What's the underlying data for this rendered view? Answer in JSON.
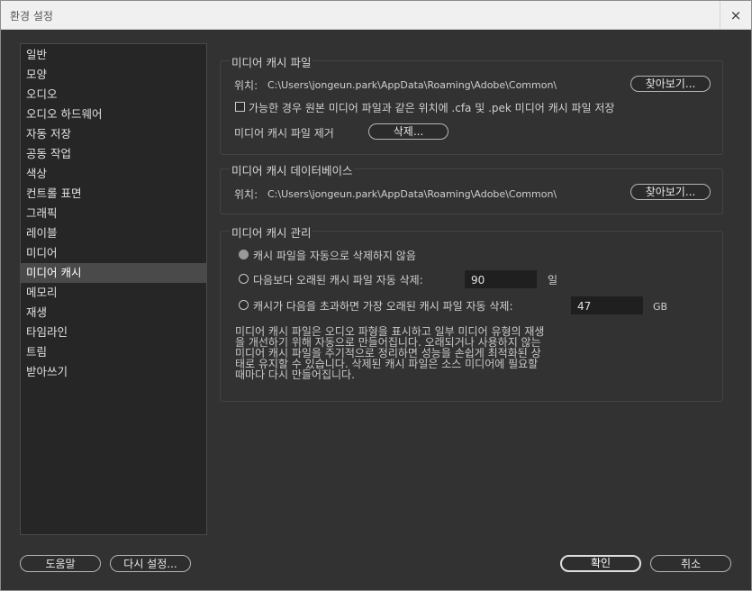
{
  "window": {
    "title": "환경 설정",
    "close_glyph": "×"
  },
  "sidebar": {
    "items": [
      {
        "label": "일반"
      },
      {
        "label": "모양"
      },
      {
        "label": "오디오"
      },
      {
        "label": "오디오 하드웨어"
      },
      {
        "label": "자동 저장"
      },
      {
        "label": "공동 작업"
      },
      {
        "label": "색상"
      },
      {
        "label": "컨트롤 표면"
      },
      {
        "label": "그래픽"
      },
      {
        "label": "레이블"
      },
      {
        "label": "미디어"
      },
      {
        "label": "미디어 캐시",
        "selected": true
      },
      {
        "label": "메모리"
      },
      {
        "label": "재생"
      },
      {
        "label": "타임라인"
      },
      {
        "label": "트림"
      },
      {
        "label": "받아쓰기"
      }
    ]
  },
  "cache_files": {
    "title": "미디어 캐시 파일",
    "location_label": "위치:",
    "location_path": "C:\\Users\\jongeun.park\\AppData\\Roaming\\Adobe\\Common\\",
    "browse_label": "찾아보기...",
    "save_next_to_originals_label": "가능한 경우 원본 미디어 파일과 같은 위치에 .cfa 및 .pek 미디어 캐시 파일 저장",
    "remove_label": "미디어 캐시 파일 제거",
    "delete_label": "삭제..."
  },
  "cache_db": {
    "title": "미디어 캐시 데이터베이스",
    "location_label": "위치:",
    "location_path": "C:\\Users\\jongeun.park\\AppData\\Roaming\\Adobe\\Common\\",
    "browse_label": "찾아보기..."
  },
  "cache_mgmt": {
    "title": "미디어 캐시 관리",
    "option_never_delete": "캐시 파일을 자동으로 삭제하지 않음",
    "option_delete_older": "다음보다 오래된 캐시 파일 자동 삭제:",
    "older_than_value": "90",
    "older_than_unit": "일",
    "option_delete_exceeds": "캐시가 다음을 초과하면 가장 오래된 캐시 파일 자동 삭제:",
    "exceeds_value": "47",
    "exceeds_unit": "GB",
    "selected_option": "never_delete",
    "description_lines": [
      "미디어 캐시 파일은 오디오 파형을 표시하고 일부 미디어 유형의 재생",
      "을 개선하기 위해 자동으로 만들어집니다. 오래되거나 사용하지 않는",
      "미디어 캐시 파일을 주기적으로 정리하면 성능을 손쉽게 최적화된 상",
      "태로 유지할 수 있습니다. 삭제된 캐시 파일은 소스 미디어에 필요할",
      "때마다 다시 만들어집니다."
    ]
  },
  "footer": {
    "help_label": "도움말",
    "reset_label": "다시 설정...",
    "ok_label": "확인",
    "cancel_label": "취소"
  }
}
